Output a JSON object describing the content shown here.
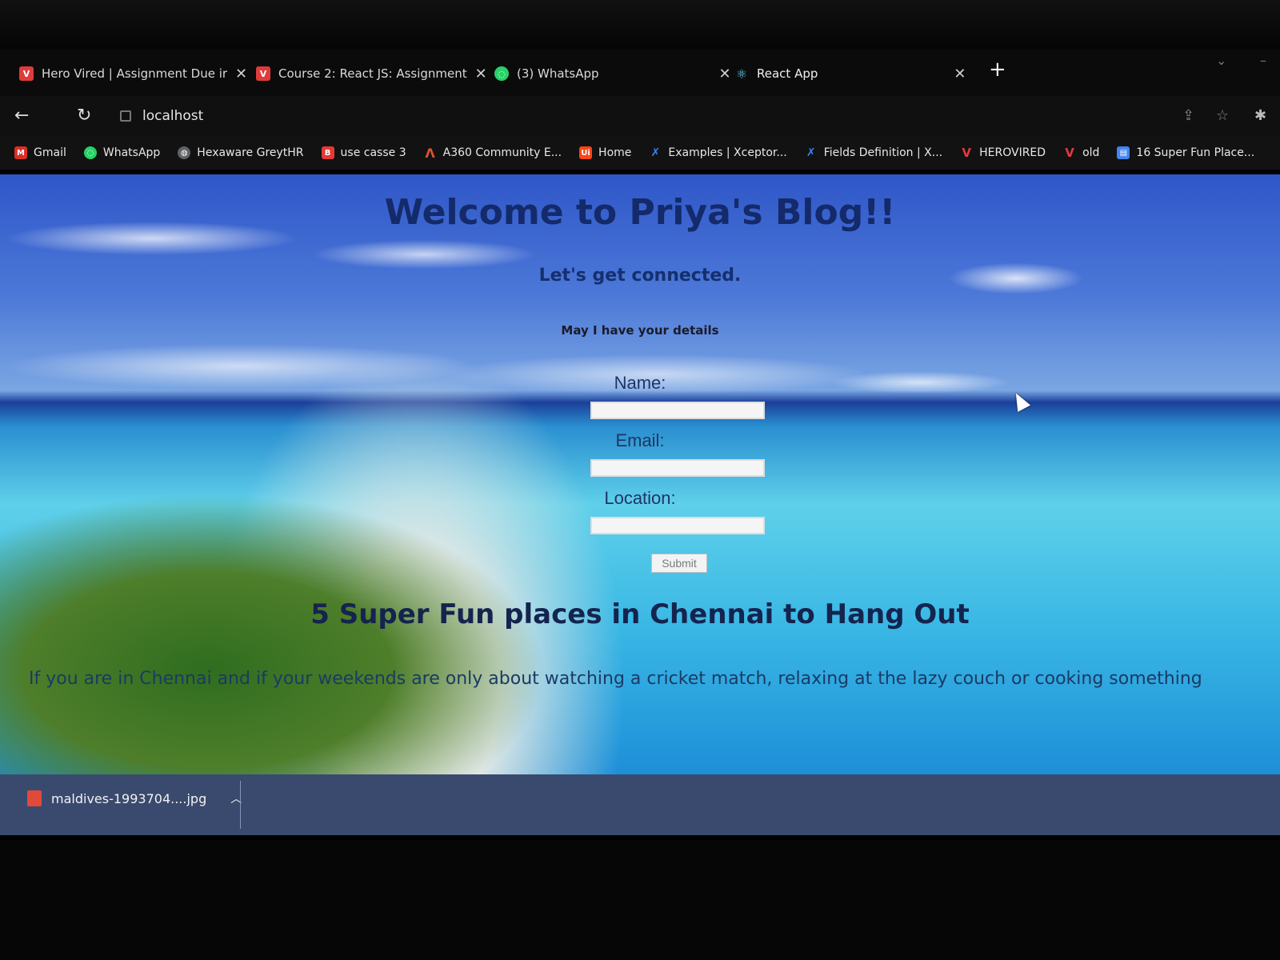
{
  "browser": {
    "tabs": [
      {
        "title": "Hero Vired | Assignment Due ir",
        "favicon": "herovired-icon",
        "color": "#e03b3b"
      },
      {
        "title": "Course 2: React JS: Assignment",
        "favicon": "herovired-icon",
        "color": "#e03b3b"
      },
      {
        "title": "(3) WhatsApp",
        "favicon": "whatsapp-icon",
        "color": "#25d366"
      },
      {
        "title": "React App",
        "favicon": "react-icon",
        "color": "#61dafb"
      }
    ],
    "address": "localhost",
    "bookmarks": [
      {
        "label": "Gmail",
        "icon": "gmail-icon",
        "color": "#d93025"
      },
      {
        "label": "WhatsApp",
        "icon": "whatsapp-icon",
        "color": "#25d366"
      },
      {
        "label": "Hexaware GreytHR",
        "icon": "globe-icon",
        "color": "#9aa0a6"
      },
      {
        "label": "use casse 3",
        "icon": "doc-icon",
        "color": "#e53935"
      },
      {
        "label": "A360 Community E...",
        "icon": "automation-anywhere-icon",
        "color": "#e0532f"
      },
      {
        "label": "Home",
        "icon": "uipath-icon",
        "color": "#fa4616"
      },
      {
        "label": "Examples | Xceptor...",
        "icon": "xceptor-icon",
        "color": "#3b82f6"
      },
      {
        "label": "Fields Definition | X...",
        "icon": "xceptor-icon",
        "color": "#3b82f6"
      },
      {
        "label": "HEROVIRED",
        "icon": "herovired-icon",
        "color": "#e03b3b"
      },
      {
        "label": "old",
        "icon": "herovired-icon",
        "color": "#e03b3b"
      },
      {
        "label": "16 Super Fun Place...",
        "icon": "bookmark-page-icon",
        "color": "#4285f4"
      }
    ]
  },
  "page": {
    "heading": "Welcome to Priya's Blog!!",
    "subheading": "Let's get connected.",
    "prompt": "May I have your details",
    "form": {
      "name_label": "Name:",
      "email_label": "Email:",
      "location_label": "Location:",
      "submit_label": "Submit"
    },
    "post_title": "5 Super Fun places in Chennai to Hang Out",
    "post_body": "If you are in Chennai and if your weekends are only about watching a cricket match, relaxing at the lazy couch or cooking something"
  },
  "downloads": {
    "file": "maldives-1993704....jpg"
  }
}
